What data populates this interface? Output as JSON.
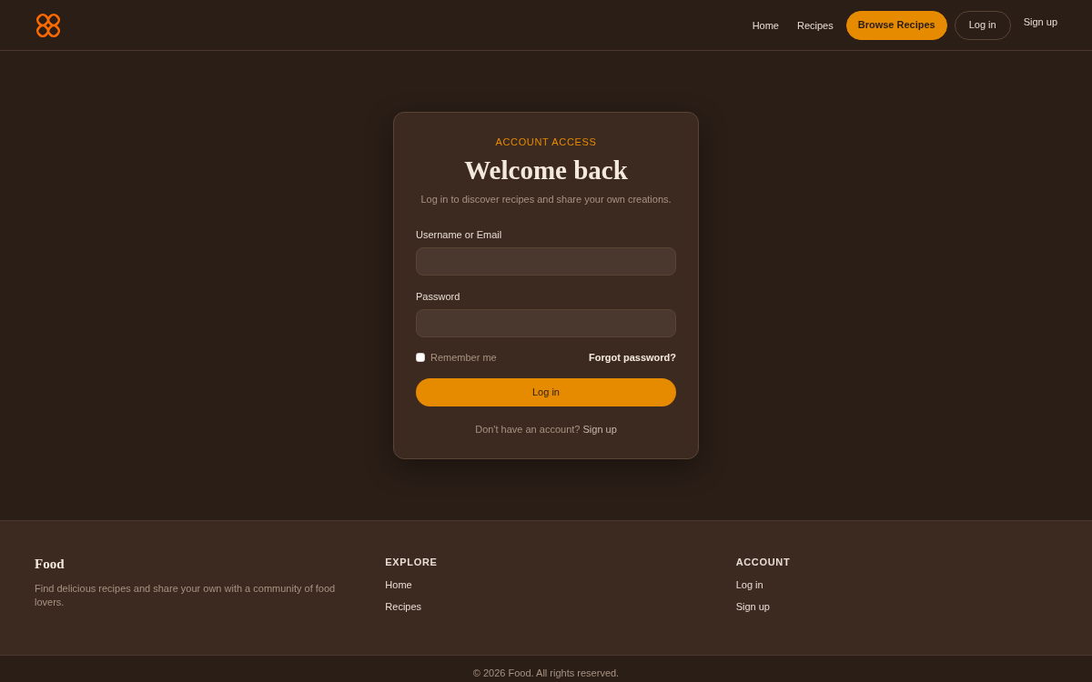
{
  "header": {
    "nav": [
      {
        "label": "Home",
        "kind": "link"
      },
      {
        "label": "Recipes",
        "kind": "link"
      },
      {
        "label": "Browse Recipes",
        "kind": "primary"
      },
      {
        "label": "Log in",
        "kind": "outline"
      },
      {
        "label": "Sign up",
        "kind": "plain"
      }
    ]
  },
  "login_card": {
    "eyebrow": "ACCOUNT ACCESS",
    "title": "Welcome back",
    "subtitle": "Log in to discover recipes and share your own creations.",
    "fields": [
      {
        "label": "Username or Email"
      },
      {
        "label": "Password"
      }
    ],
    "remember": {
      "label": "Remember me",
      "checked": false
    },
    "forgot_link": "Forgot password?",
    "submit": "Log in",
    "signup_prompt": "Don't have an account?",
    "signup_link": "Sign up"
  },
  "footer": {
    "brand": "Food",
    "description": "Find delicious recipes and share your own with a community of food lovers.",
    "columns": [
      {
        "heading": "EXPLORE",
        "links": [
          "Home",
          "Recipes"
        ]
      },
      {
        "heading": "ACCOUNT",
        "links": [
          "Log in",
          "Sign up"
        ]
      }
    ],
    "copyright": "© 2026 Food. All rights reserved."
  }
}
